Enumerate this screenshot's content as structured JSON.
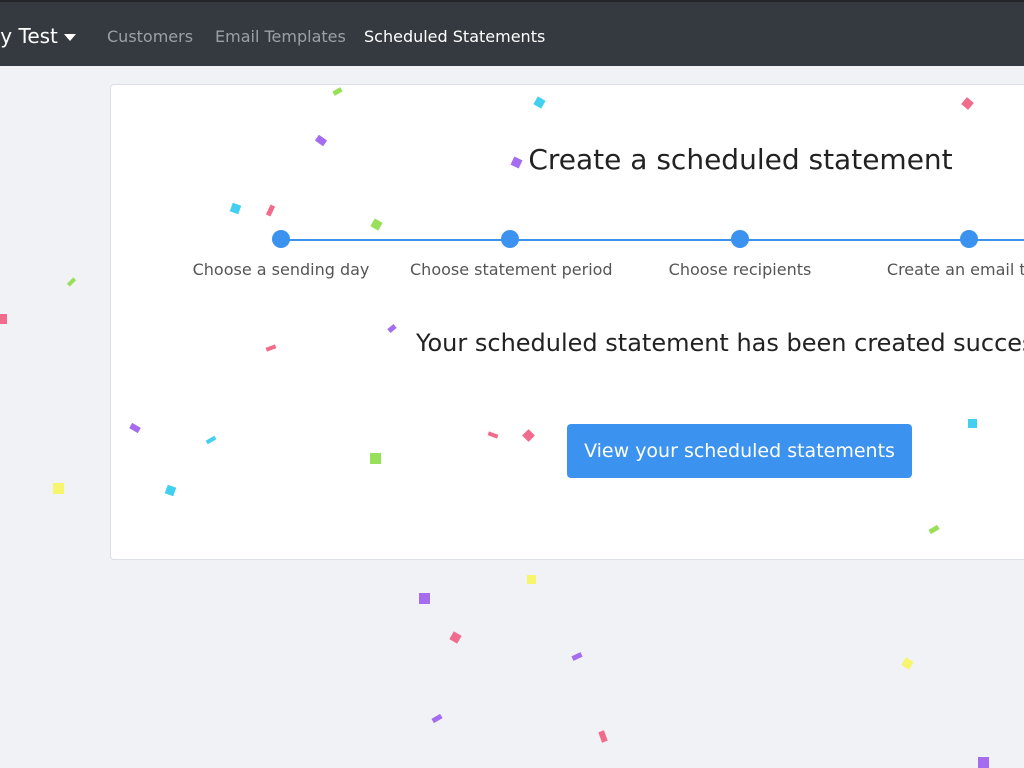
{
  "navbar": {
    "brand": "ey Test",
    "links": [
      {
        "label": "Customers",
        "active": false
      },
      {
        "label": "Email Templates",
        "active": false
      },
      {
        "label": "Scheduled Statements",
        "active": true
      }
    ]
  },
  "card": {
    "title": "Create a scheduled statement",
    "steps": [
      "Choose a sending day",
      "Choose statement period",
      "Choose recipients",
      "Create an email tem"
    ],
    "success_message": "Your scheduled statement has been created successfu",
    "button_label": "View your scheduled statements"
  },
  "colors": {
    "navbar_bg": "#343a40",
    "accent": "#3b93ef",
    "page_bg": "#f1f2f5"
  },
  "confetti_colors": [
    "#f16c8c",
    "#a56cf0",
    "#43cff0",
    "#98e05a",
    "#f7f56e"
  ]
}
